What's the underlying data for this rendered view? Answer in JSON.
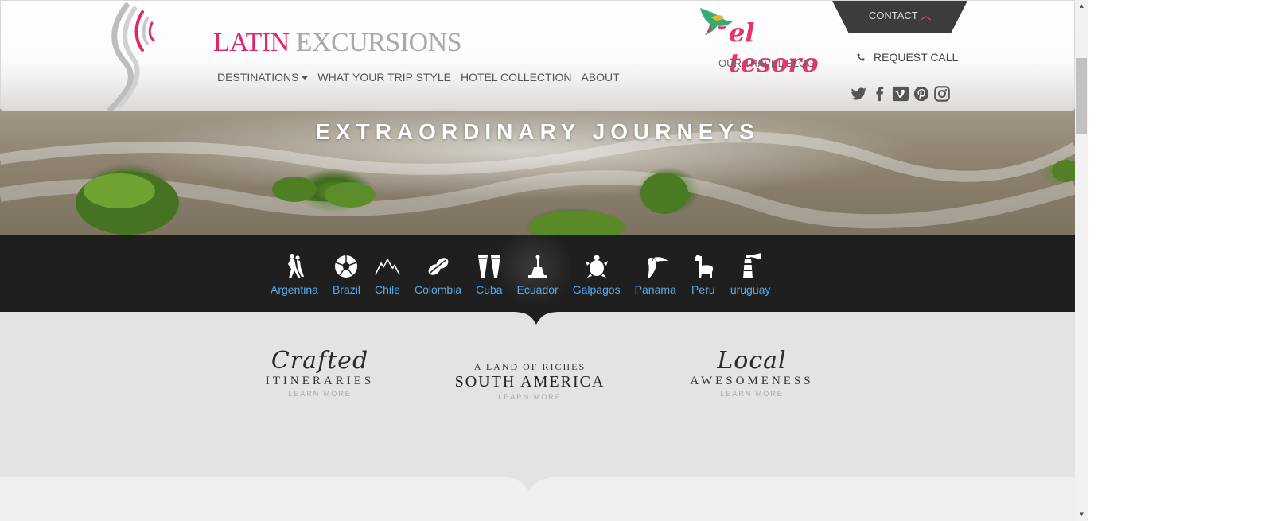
{
  "brand": {
    "word1": "LATIN",
    "word2": "EXCURSIONS"
  },
  "nav": {
    "items": [
      {
        "label": "DESTINATIONS",
        "dropdown": true
      },
      {
        "label": "WHAT YOUR TRIP STYLE"
      },
      {
        "label": "HOTEL COLLECTION"
      },
      {
        "label": "ABOUT"
      }
    ]
  },
  "blog": {
    "logo_text": "el tesoro",
    "label": "OUR TRAVEL BLOG"
  },
  "contact": {
    "label": "CONTACT",
    "icon": "chevron-up-icon"
  },
  "request_call": {
    "label": "REQUEST CALL",
    "icon": "phone-icon"
  },
  "social": [
    "twitter-icon",
    "facebook-icon",
    "vimeo-icon",
    "pinterest-icon",
    "instagram-icon"
  ],
  "hero": {
    "title": "EXTRAORDINARY JOURNEYS"
  },
  "destinations": [
    {
      "label": "Argentina",
      "icon": "tango-dancers-icon"
    },
    {
      "label": "Brazil",
      "icon": "soccer-ball-icon"
    },
    {
      "label": "Chile",
      "icon": "mountains-icon"
    },
    {
      "label": "Colombia",
      "icon": "coffee-beans-icon"
    },
    {
      "label": "Cuba",
      "icon": "conga-drums-icon"
    },
    {
      "label": "Ecuador",
      "icon": "monument-icon"
    },
    {
      "label": "Galpagos",
      "icon": "turtle-icon"
    },
    {
      "label": "Panama",
      "icon": "toucan-icon"
    },
    {
      "label": "Peru",
      "icon": "llama-icon"
    },
    {
      "label": "uruguay",
      "icon": "lighthouse-icon"
    }
  ],
  "features": {
    "crafted": {
      "script": "Crafted",
      "caps": "ITINERARIES",
      "link": "LEARN MORE"
    },
    "land": {
      "small": "A LAND OF RICHES",
      "big": "SOUTH AMERICA",
      "link": "LEARN MORE"
    },
    "local": {
      "script": "Local",
      "caps": "AWESOMENESS",
      "link": "LEARN MORE"
    }
  },
  "colors": {
    "accent": "#e0256c",
    "brand_gray": "#a9a9a9",
    "dest_link": "#58a9ea",
    "band": "#1f1f1f"
  }
}
